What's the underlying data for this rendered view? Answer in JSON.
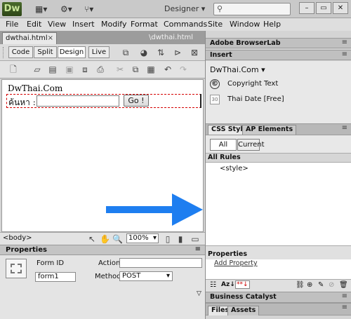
{
  "app": {
    "logo": "Dw",
    "workspace": "Designer",
    "workspace_arrow": "▾"
  },
  "menu": [
    "File",
    "Edit",
    "View",
    "Insert",
    "Modify",
    "Format",
    "Commands",
    "Site",
    "Window",
    "Help"
  ],
  "document": {
    "filename": "dwthai.html",
    "close": "×",
    "path": "\\dwthai.html",
    "views": [
      "Code",
      "Split",
      "Design",
      "Live"
    ],
    "heading": "DwThai.Com",
    "search_label": "ค้นหา :",
    "go_button": "Go !"
  },
  "status": {
    "tag": "<body>",
    "zoom": "100%"
  },
  "properties": {
    "title": "Properties",
    "form_id_label": "Form ID",
    "form_id_value": "form1",
    "action_label": "Action",
    "action_value": "",
    "method_label": "Method",
    "method_value": "POST"
  },
  "right_panel": {
    "browserlab": "Adobe BrowserLab",
    "insert": "Insert",
    "insert_category": "DwThai.Com",
    "insert_items": [
      {
        "icon": "©",
        "label": "Copyright Text"
      },
      {
        "icon": "30",
        "label": "Thai Date [Free]"
      }
    ],
    "css_tabs": [
      "CSS Styles",
      "AP Elements"
    ],
    "css_modes": [
      "All",
      "Current"
    ],
    "all_rules": "All Rules",
    "rules": [
      "<style>"
    ],
    "properties_title": "Properties",
    "add_property": "Add Property",
    "business_catalyst": "Business Catalyst",
    "bottom_tabs": [
      "Files",
      "Assets"
    ]
  },
  "colors": {
    "accent_arrow": "#1e7ef0",
    "form_border": "#d40000",
    "logo_bg": "#3a5720"
  }
}
